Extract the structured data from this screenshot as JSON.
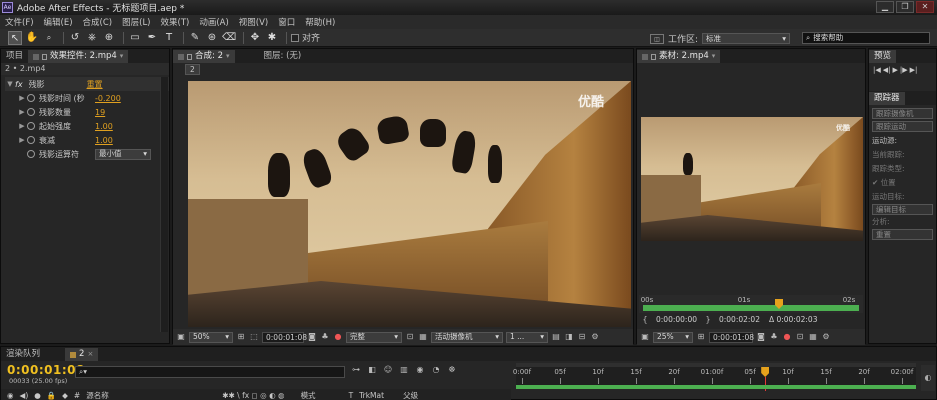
{
  "window": {
    "app_icon": "Ae",
    "title": "Adobe After Effects - 无标题项目.aep *",
    "buttons": {
      "minimize": "▁",
      "restore": "❐",
      "close": "✕"
    }
  },
  "menu": [
    "文件(F)",
    "编辑(E)",
    "合成(C)",
    "图层(L)",
    "效果(T)",
    "动画(A)",
    "视图(V)",
    "窗口",
    "帮助(H)"
  ],
  "toolbar": {
    "tools": [
      "selection-tool",
      "hand-tool",
      "zoom-tool",
      "rotate-tool",
      "camera-tool",
      "pan-behind-tool",
      "rectangle-tool",
      "pen-tool",
      "type-tool",
      "brush-tool",
      "clone-tool",
      "eraser-tool",
      "roto-brush-tool",
      "puppet-tool"
    ],
    "tool_glyphs": [
      "↖",
      "✋",
      "🔍",
      "↺",
      "⎈",
      "⊕",
      "▭",
      "✒",
      "T",
      "✎",
      "⊛",
      "⌫",
      "✥",
      "✱"
    ],
    "align_label": "对齐",
    "workspace_label": "工作区:",
    "workspace_value": "标准",
    "search_placeholder": "搜索帮助"
  },
  "left_panel": {
    "tab_project": "项目",
    "tab_effects": "效果控件: 2.mp4",
    "breadcrumb": "2 • 2.mp4",
    "effect": {
      "name": "残影",
      "reset": "重置",
      "props": [
        {
          "label": "残影时间 (秒",
          "value": "-0.200"
        },
        {
          "label": "残影数量",
          "value": "19"
        },
        {
          "label": "起始强度",
          "value": "1.00"
        },
        {
          "label": "衰减",
          "value": "1.00"
        },
        {
          "label": "残影运算符",
          "value": "最小值"
        }
      ]
    }
  },
  "comp_panel": {
    "tab_label": "合成: 2",
    "layer_label": "图层: (无)",
    "comp_name": "2",
    "watermark": "优酷",
    "zoom": "50%",
    "timecode": "0:00:01:08",
    "resolution": "完整",
    "camera": "活动摄像机",
    "views": "1 ..."
  },
  "footage_panel": {
    "tab_label": "素材: 2.mp4",
    "watermark": "优酷",
    "ruler": [
      "00s",
      "01s",
      "02s"
    ],
    "in_time": "0:00:00:00",
    "out_time": "0:00:02:02",
    "duration": "Δ 0:00:02:03",
    "zoom": "25%",
    "timecode": "0:00:01:08"
  },
  "right_panel": {
    "tab_preview": "预览",
    "preview_controls": [
      "|◀",
      "◀|",
      "▶",
      "|▶",
      "▶|"
    ],
    "tab_tracker": "跟踪器",
    "tracker_buttons": [
      "跟踪摄像机",
      "跟踪运动"
    ],
    "motion_source_label": "运动源:",
    "current_track_label": "当前跟踪:",
    "track_type_label": "跟踪类型:",
    "position_label": "位置",
    "motion_target_label": "运动目标:",
    "edit_target_label": "编辑目标",
    "analyze_label": "分析:",
    "reset_label": "重置"
  },
  "timeline": {
    "tab_render": "渲染队列",
    "tab_comp": "2",
    "timecode": "0:00:01:08",
    "frame_info": "00033 (25.00 fps)",
    "search_placeholder": "",
    "col_source": "源名称",
    "col_mode": "模式",
    "col_trkmat": "TrkMat",
    "col_parent": "父级",
    "ruler": [
      "0:00f",
      "05f",
      "10f",
      "15f",
      "20f",
      "01:00f",
      "05f",
      "10f",
      "15f",
      "20f",
      "02:00f"
    ],
    "playhead_fraction": 0.64
  },
  "colors": {
    "timecode_yellow": "#f0c020",
    "link_orange": "#e0a020",
    "work_area_green": "#4caf50",
    "playhead_orange": "#e6a21c"
  }
}
